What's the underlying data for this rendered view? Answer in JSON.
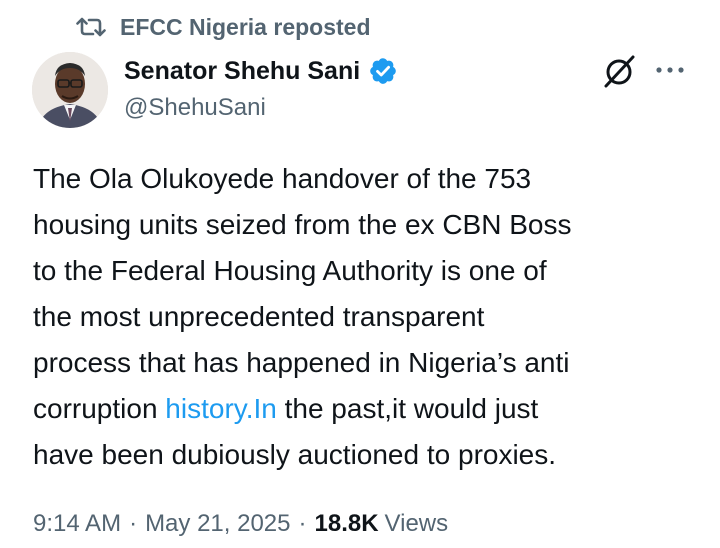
{
  "repost": {
    "text": "EFCC Nigeria reposted",
    "icon": "repost-icon"
  },
  "author": {
    "display_name": "Senator Shehu Sani",
    "handle": "@ShehuSani",
    "verified_color": "#1d9bf0"
  },
  "tweet": {
    "lines": [
      "The Ola Olukoyede handover of the 753",
      "housing units seized from the ex CBN Boss",
      "to the Federal Housing Authority is one of",
      "the most unprecedented transparent",
      "process that has happened in Nigeria’s anti"
    ],
    "line6_before_link": "corruption ",
    "link_text": "history.In",
    "line6_after_link": " the past,it would just",
    "line7": "have been dubiously auctioned to proxies."
  },
  "meta": {
    "time": "9:14 AM",
    "separator": "·",
    "date": "May 21, 2025",
    "views_count": "18.8K",
    "views_label": "Views"
  },
  "colors": {
    "link": "#1d9bf0",
    "secondary_text": "#536471",
    "primary_text": "#0f1419"
  }
}
